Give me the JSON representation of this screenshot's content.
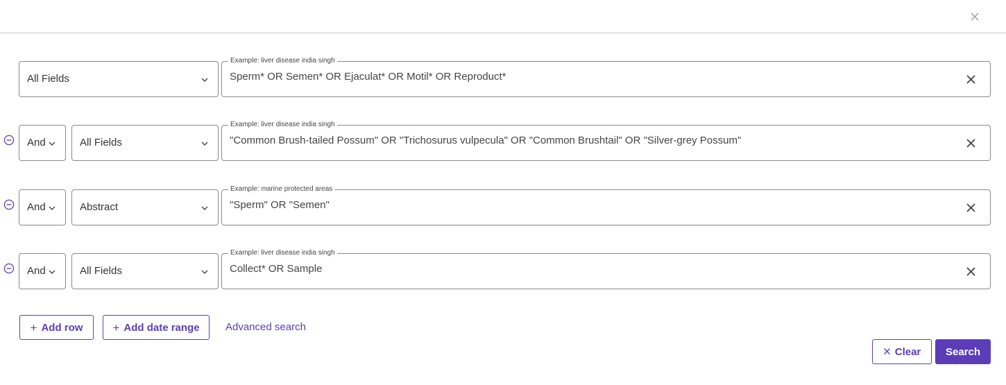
{
  "colors": {
    "accent": "#5c3db8",
    "border": "#8a8a8a",
    "text": "#333333"
  },
  "header": {
    "close_icon": "close-icon"
  },
  "rows": [
    {
      "operator": "",
      "field": "All Fields",
      "placeholder": "Example: liver disease india singh",
      "query": "Sperm* OR Semen* OR Ejaculat* OR Motil* OR Reproduct*"
    },
    {
      "operator": "And",
      "field": "All Fields",
      "placeholder": "Example: liver disease india singh",
      "query": "\"Common Brush-tailed Possum\" OR \"Trichosurus vulpecula\" OR \"Common Brushtail\" OR \"Silver-grey Possum\""
    },
    {
      "operator": "And",
      "field": "Abstract",
      "placeholder": "Example: marine protected areas",
      "query": "\"Sperm\" OR \"Semen\""
    },
    {
      "operator": "And",
      "field": "All Fields",
      "placeholder": "Example: liver disease india singh",
      "query": "Collect* OR Sample"
    }
  ],
  "actions": {
    "add_row_label": "Add row",
    "add_date_range_label": "Add date range",
    "advanced_search_label": "Advanced search",
    "clear_label": "Clear",
    "search_label": "Search"
  }
}
